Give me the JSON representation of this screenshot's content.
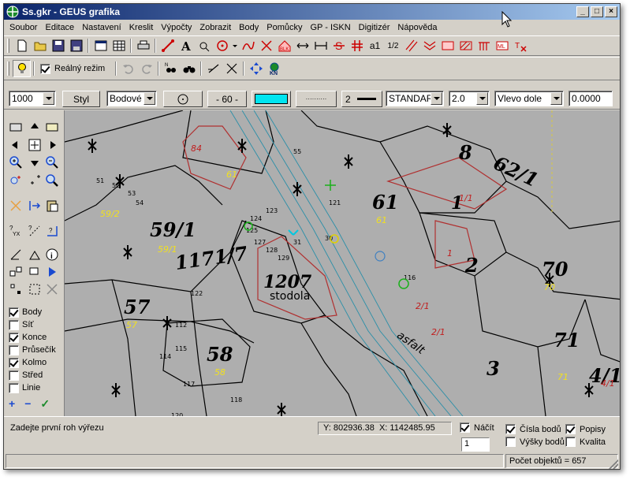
{
  "window": {
    "title": "Ss.gkr - GEUS grafika",
    "minimize": "_",
    "maximize": "□",
    "close": "×"
  },
  "menu": [
    "Soubor",
    "Editace",
    "Nastavení",
    "Kreslit",
    "Výpočty",
    "Zobrazit",
    "Body",
    "Pomůcky",
    "GP - ISKN",
    "Digitizér",
    "Nápověda"
  ],
  "toolbar2": {
    "real_mode_label": "Reálný režim",
    "real_mode_checked": true,
    "text_a1": "a1",
    "text_frac": "1/2"
  },
  "propbar": {
    "scale": "1000",
    "style_button": "Styl",
    "point_type": "Bodové",
    "line_pattern": "- 60 -",
    "fill_color": "#00e5f0",
    "dotted": "··········",
    "line_width": "2",
    "font_name": "STANDAR",
    "text_height": "2.0",
    "alignment": "Vlevo dole",
    "angle": "0.0000"
  },
  "layers": [
    {
      "label": "Body",
      "checked": true
    },
    {
      "label": "Síť",
      "checked": false
    },
    {
      "label": "Konce",
      "checked": true
    },
    {
      "label": "Průsečík",
      "checked": false
    },
    {
      "label": "Kolmo",
      "checked": true
    },
    {
      "label": "Střed",
      "checked": false
    },
    {
      "label": "Linie",
      "checked": false
    }
  ],
  "layer_actions": {
    "add": "+",
    "remove": "−",
    "ok": "✓"
  },
  "status": {
    "prompt": "Zadejte první roh výřezu",
    "coord_y": "Y: 802936.38",
    "coord_x": "X: 1142485.95",
    "nacit_label": "Náčít",
    "nacit_checked": true,
    "nacit_value": "1",
    "cisla_bodu": "Čísla bodů",
    "cisla_bodu_checked": true,
    "vysky_bodu": "Výšky bodů",
    "vysky_bodu_checked": false,
    "popisy": "Popisy",
    "popisy_checked": true,
    "kvalita": "Kvalita",
    "kvalita_checked": false,
    "object_count": "Počet objektů = 657"
  },
  "map": {
    "parcels_black": [
      "59/1",
      "57",
      "58",
      "1207",
      "61",
      "70",
      "71",
      "62/1",
      "1171/7",
      "1",
      "2",
      "8",
      "3",
      "4/1"
    ],
    "parcels_yellow": [
      "59/2",
      "59/1",
      "57",
      "58",
      "61",
      "70",
      "71",
      "61"
    ],
    "labels_red": [
      "84",
      "1/1",
      "2/1",
      "2/1",
      "4/1",
      "1"
    ],
    "stodola": "stodola",
    "asfalt": "asfalt",
    "point_numbers": [
      "123",
      "124",
      "125",
      "127",
      "128",
      "129",
      "121",
      "122",
      "31",
      "30",
      "116",
      "115",
      "114",
      "112",
      "118",
      "117",
      "120",
      "51",
      "52",
      "53",
      "54",
      "55"
    ]
  }
}
